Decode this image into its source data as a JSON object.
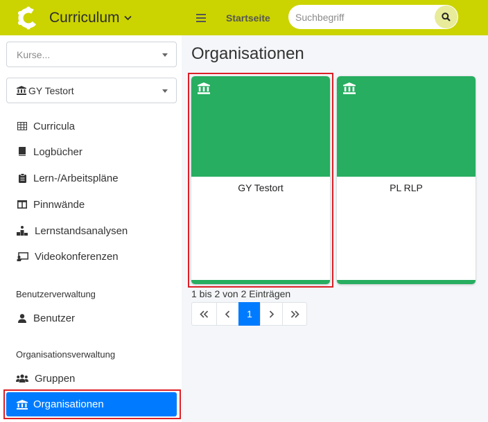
{
  "app": {
    "title": "Curriculum"
  },
  "topnav": {
    "home_label": "Startseite"
  },
  "search": {
    "placeholder": "Suchbegriff"
  },
  "sidebar": {
    "course_select_placeholder": "Kurse...",
    "org_select_value": "GY Testort",
    "items": [
      {
        "label": "Curricula",
        "icon": "table-icon"
      },
      {
        "label": "Logbücher",
        "icon": "book-icon"
      },
      {
        "label": "Lern-/Arbeitspläne",
        "icon": "clipboard-icon"
      },
      {
        "label": "Pinnwände",
        "icon": "columns-icon"
      },
      {
        "label": "Lernstandsanalysen",
        "icon": "podium-icon"
      },
      {
        "label": "Videokonferenzen",
        "icon": "chalkboard-icon"
      }
    ],
    "user_section": {
      "header": "Benutzerverwaltung",
      "items": [
        {
          "label": "Benutzer",
          "icon": "user-icon"
        }
      ]
    },
    "org_section": {
      "header": "Organisationsverwaltung",
      "items": [
        {
          "label": "Gruppen",
          "icon": "users-icon"
        },
        {
          "label": "Organisationen",
          "icon": "institution-icon",
          "active": true
        }
      ]
    }
  },
  "main": {
    "title": "Organisationen",
    "cards": [
      {
        "name": "GY Testort",
        "icon": "institution-icon"
      },
      {
        "name": "PL RLP",
        "icon": "institution-icon"
      }
    ],
    "entries_text": "1 bis 2 von 2 Einträgen",
    "pagination": {
      "current_page": "1"
    }
  },
  "colors": {
    "brand": "#cbd400",
    "card_green": "#27ae60",
    "active_blue": "#007bff",
    "highlight_red": "#dc1f26"
  }
}
